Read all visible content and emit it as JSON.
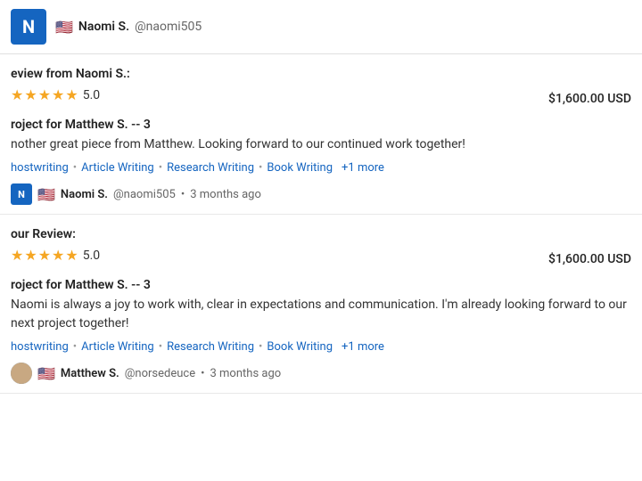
{
  "top_user": {
    "initial": "N",
    "flag": "🇺🇸",
    "name": "Naomi S.",
    "handle": "@naomi505"
  },
  "review1": {
    "from_label": "eview from Naomi S.:",
    "rating": "5.0",
    "price": "$1,600.00 USD",
    "project_title": "roject for Matthew S. -- 3",
    "review_text": "nother great piece from Matthew. Looking forward to our continued work together!",
    "tags": [
      "hostwriting",
      "Article Writing",
      "Research Writing",
      "Book Writing"
    ],
    "more_label": "+1 more",
    "reviewer": {
      "initial": "N",
      "flag": "🇺🇸",
      "name": "Naomi S.",
      "handle": "@naomi505",
      "time": "3 months ago"
    }
  },
  "review2": {
    "from_label": "our Review:",
    "rating": "5.0",
    "price": "$1,600.00 USD",
    "project_title": "roject for Matthew S. -- 3",
    "review_text": "Naomi is always a joy to work with, clear in expectations and communication. I'm already looking forward to our next project together!",
    "tags": [
      "hostwriting",
      "Article Writing",
      "Research Writing",
      "Book Writing"
    ],
    "more_label": "+1 more",
    "reviewer": {
      "name": "Matthew S.",
      "handle": "@norsedeuce",
      "time": "3 months ago"
    }
  },
  "stars": "★★★★",
  "half_star": "★"
}
